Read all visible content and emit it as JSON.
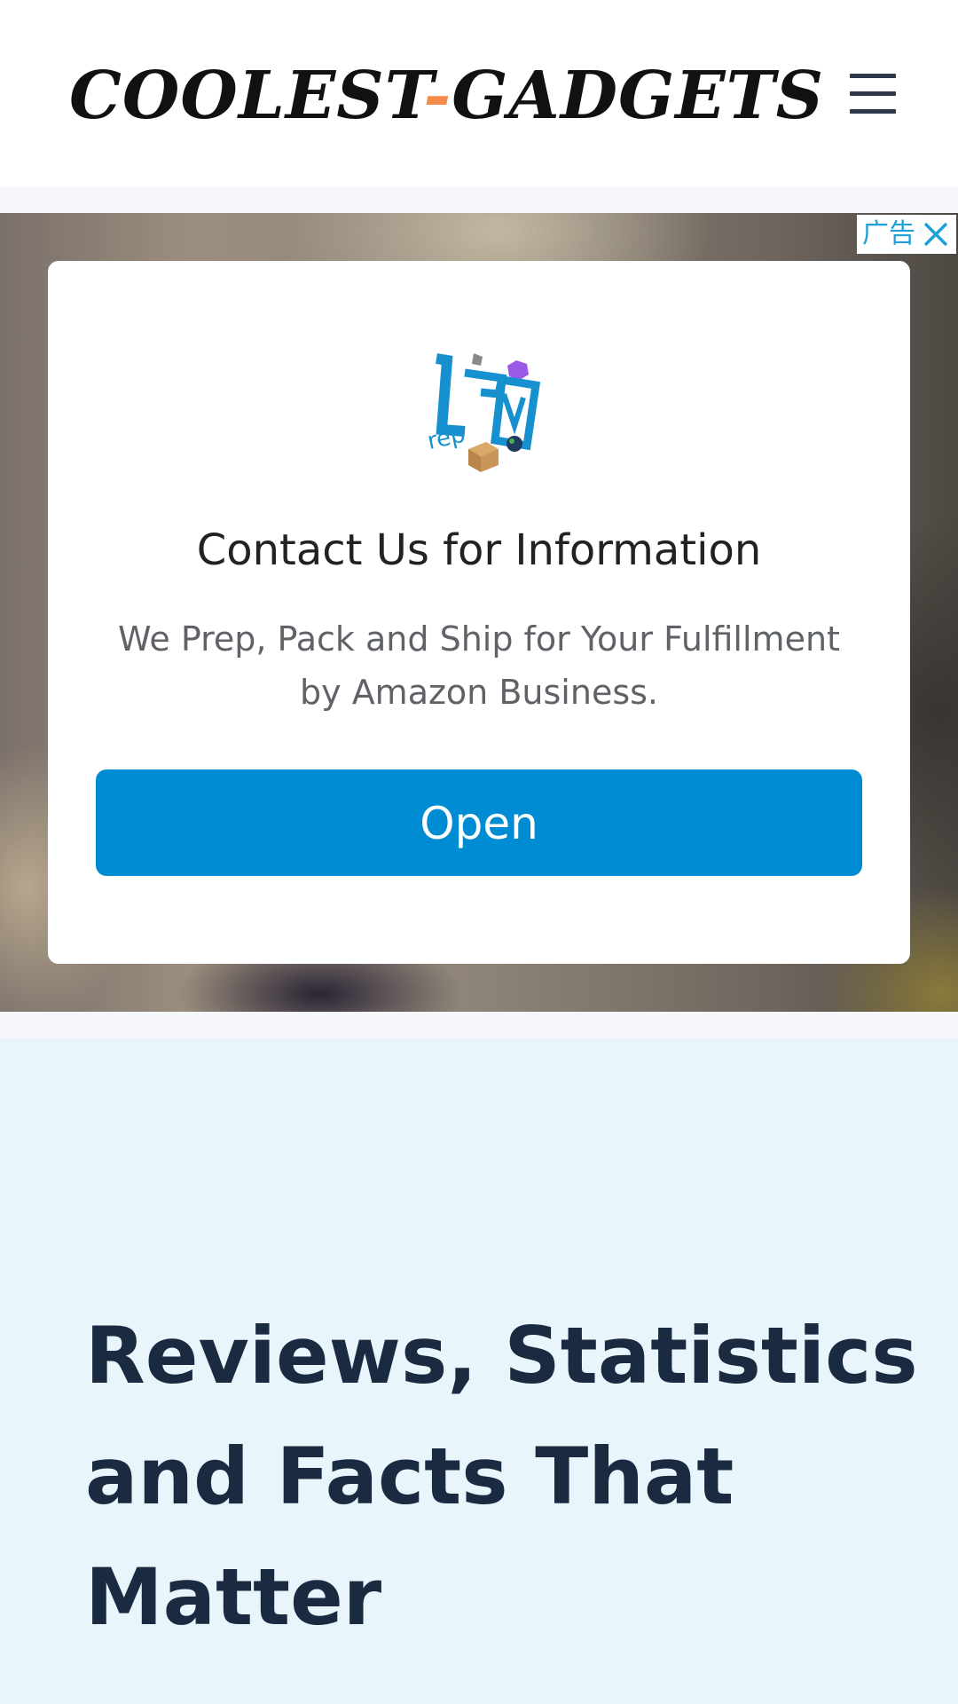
{
  "header": {
    "logo_left": "COOLEST",
    "logo_dash": "-",
    "logo_right": "GADGETS",
    "menu_icon": "hamburger-menu-icon"
  },
  "ad": {
    "choice_label": "广告",
    "close_icon": "close-icon",
    "logo_icon": "uprep-logo-icon",
    "logo_text": "rep",
    "title": "Contact Us for Information",
    "description": "We Prep, Pack and Ship for Your Fulfillment by Amazon Business.",
    "button_label": "Open",
    "button_color": "#008cd3"
  },
  "hero": {
    "title": "Reviews, Statistics and Facts That Matter",
    "background_color": "#e8f5fb"
  }
}
